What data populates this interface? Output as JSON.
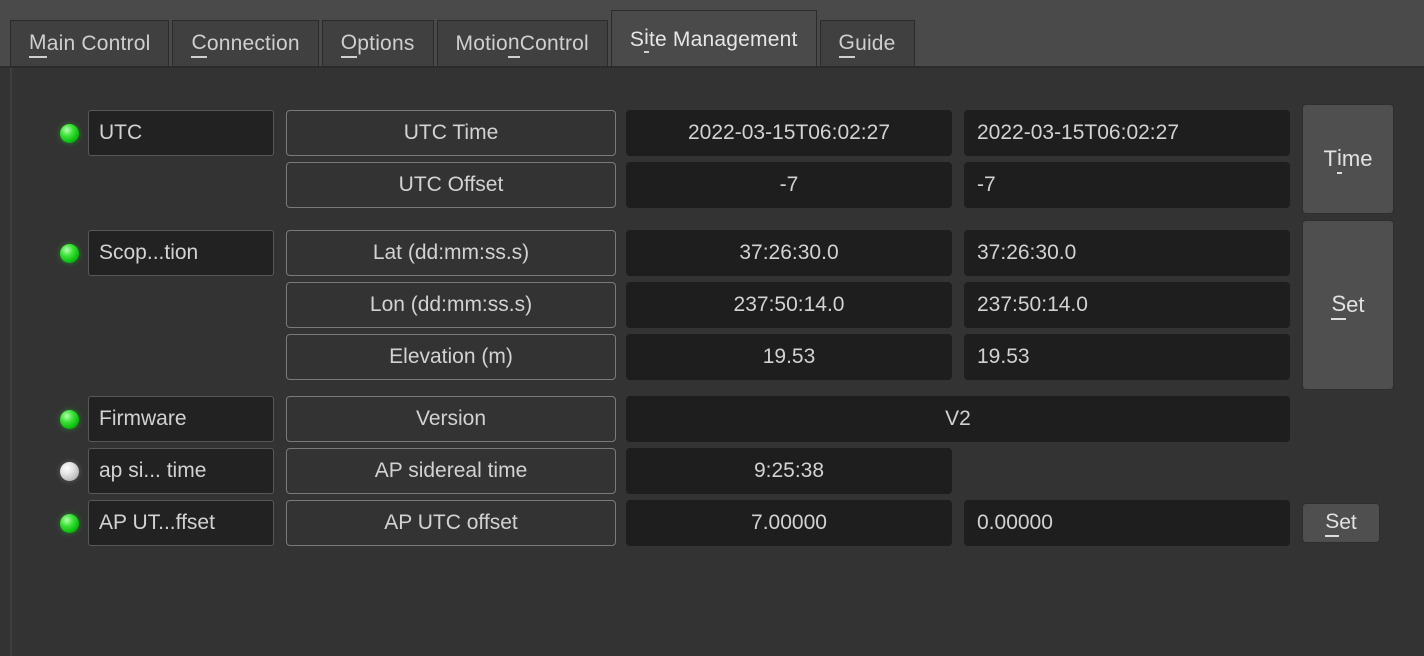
{
  "tabs": [
    {
      "label": "Main Control",
      "mnemonic": "M",
      "active": false
    },
    {
      "label": "Connection",
      "mnemonic": "C",
      "active": false
    },
    {
      "label": "Options",
      "mnemonic": "O",
      "active": false
    },
    {
      "label": "Motion Control",
      "mnemonic": "n",
      "active": false
    },
    {
      "label": "Site Management",
      "mnemonic": "i",
      "active": true
    },
    {
      "label": "Guide",
      "mnemonic": "G",
      "active": false
    }
  ],
  "colors": {
    "led_on": "#2ee02e",
    "led_off": "#e0e0e0",
    "panel_bg": "#333333",
    "tabbar_bg": "#4a4a4a",
    "value_bg": "#1e1e1e",
    "text": "#d2d2d2"
  },
  "groups": [
    {
      "name": "utc",
      "led": "on",
      "namebox": "UTC",
      "action": {
        "label": "Time",
        "mnemonic": "i",
        "size": "tall-short"
      },
      "rows": [
        {
          "label": "UTC Time",
          "current": "2022-03-15T06:02:27",
          "input": "2022-03-15T06:02:27"
        },
        {
          "label": "UTC Offset",
          "current": "-7",
          "input": "-7"
        }
      ]
    },
    {
      "name": "scope-location",
      "led": "on",
      "namebox": "Scop...tion",
      "action": {
        "label": "Set",
        "mnemonic": "S",
        "size": "tall-long"
      },
      "rows": [
        {
          "label": "Lat (dd:mm:ss.s)",
          "current": "37:26:30.0",
          "input": "37:26:30.0"
        },
        {
          "label": "Lon (dd:mm:ss.s)",
          "current": "237:50:14.0",
          "input": "237:50:14.0"
        },
        {
          "label": "Elevation (m)",
          "current": "19.53",
          "input": "19.53"
        }
      ]
    },
    {
      "name": "firmware",
      "led": "on",
      "namebox": "Firmware",
      "action": null,
      "rows": [
        {
          "label": "Version",
          "current": "V2",
          "input": null,
          "wide": true
        }
      ]
    },
    {
      "name": "ap-sidereal-time",
      "led": "off",
      "namebox": "ap si... time",
      "action": null,
      "rows": [
        {
          "label": "AP sidereal time",
          "current": "9:25:38",
          "input": null
        }
      ]
    },
    {
      "name": "ap-utc-offset",
      "led": "on",
      "namebox": "AP UT...ffset",
      "action": {
        "label": "Set",
        "mnemonic": "S",
        "size": "small"
      },
      "rows": [
        {
          "label": "AP UTC offset",
          "current": "7.00000",
          "input": "0.00000"
        }
      ]
    }
  ]
}
